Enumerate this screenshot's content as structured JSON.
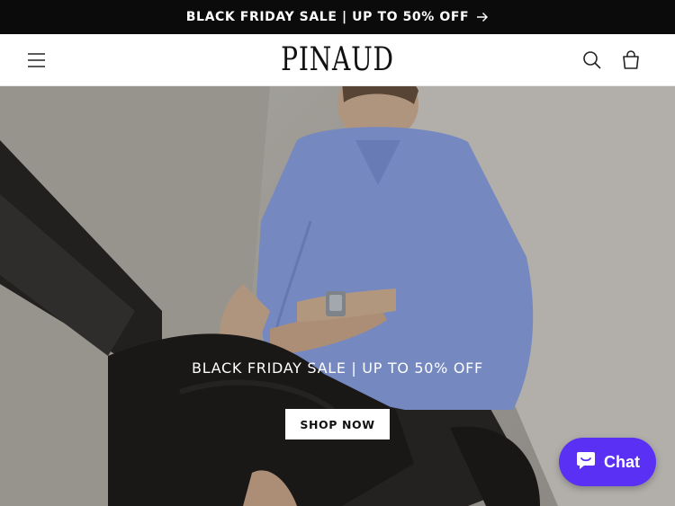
{
  "announcement": {
    "text": "BLACK FRIDAY SALE | UP TO 50% OFF",
    "icon": "arrow-right-icon"
  },
  "header": {
    "logo": "PINAUD",
    "menu_icon": "hamburger-icon",
    "search_icon": "search-icon",
    "cart_icon": "cart-icon"
  },
  "hero": {
    "title": "BLACK FRIDAY SALE | UP TO 50% OFF",
    "button_label": "SHOP NOW"
  },
  "chat": {
    "label": "Chat",
    "icon": "chat-bubble-icon",
    "color": "#5a31f4"
  },
  "colors": {
    "announcement_bg": "#0b0b0b",
    "shirt": "#8fa6ea"
  }
}
